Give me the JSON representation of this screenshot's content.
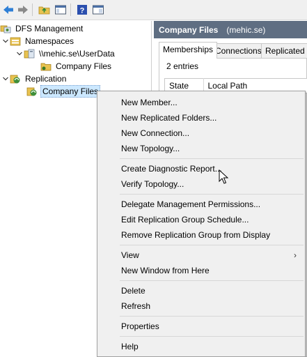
{
  "toolbar": {
    "buttons": [
      "back-arrow",
      "forward-arrow",
      "up-folder",
      "show-hide-console-tree",
      "help",
      "properties-pane"
    ]
  },
  "tree": {
    "root": "DFS Management",
    "namespaces": "Namespaces",
    "namespace_path": "\\\\mehic.se\\UserData",
    "namespace_folder": "Company Files",
    "replication": "Replication",
    "replication_group": "Company Files"
  },
  "right": {
    "title": "Company Files",
    "subtitle": "(mehic.se)",
    "tabs": [
      "Memberships",
      "Connections",
      "Replicated Fo"
    ],
    "entries": "2 entries",
    "columns": [
      "State",
      "Local Path"
    ]
  },
  "menu": {
    "items": [
      "New Member...",
      "New Replicated Folders...",
      "New Connection...",
      "New Topology...",
      "Create Diagnostic Report...",
      "Verify Topology...",
      "Delegate Management Permissions...",
      "Edit Replication Group Schedule...",
      "Remove Replication Group from Display",
      "View",
      "New Window from Here",
      "Delete",
      "Refresh",
      "Properties",
      "Help"
    ],
    "submenu_arrow": "›"
  },
  "colors": {
    "header_bg": "#5f6e82",
    "selection": "#cce8ff",
    "menu_bg": "#f0f0f0"
  }
}
